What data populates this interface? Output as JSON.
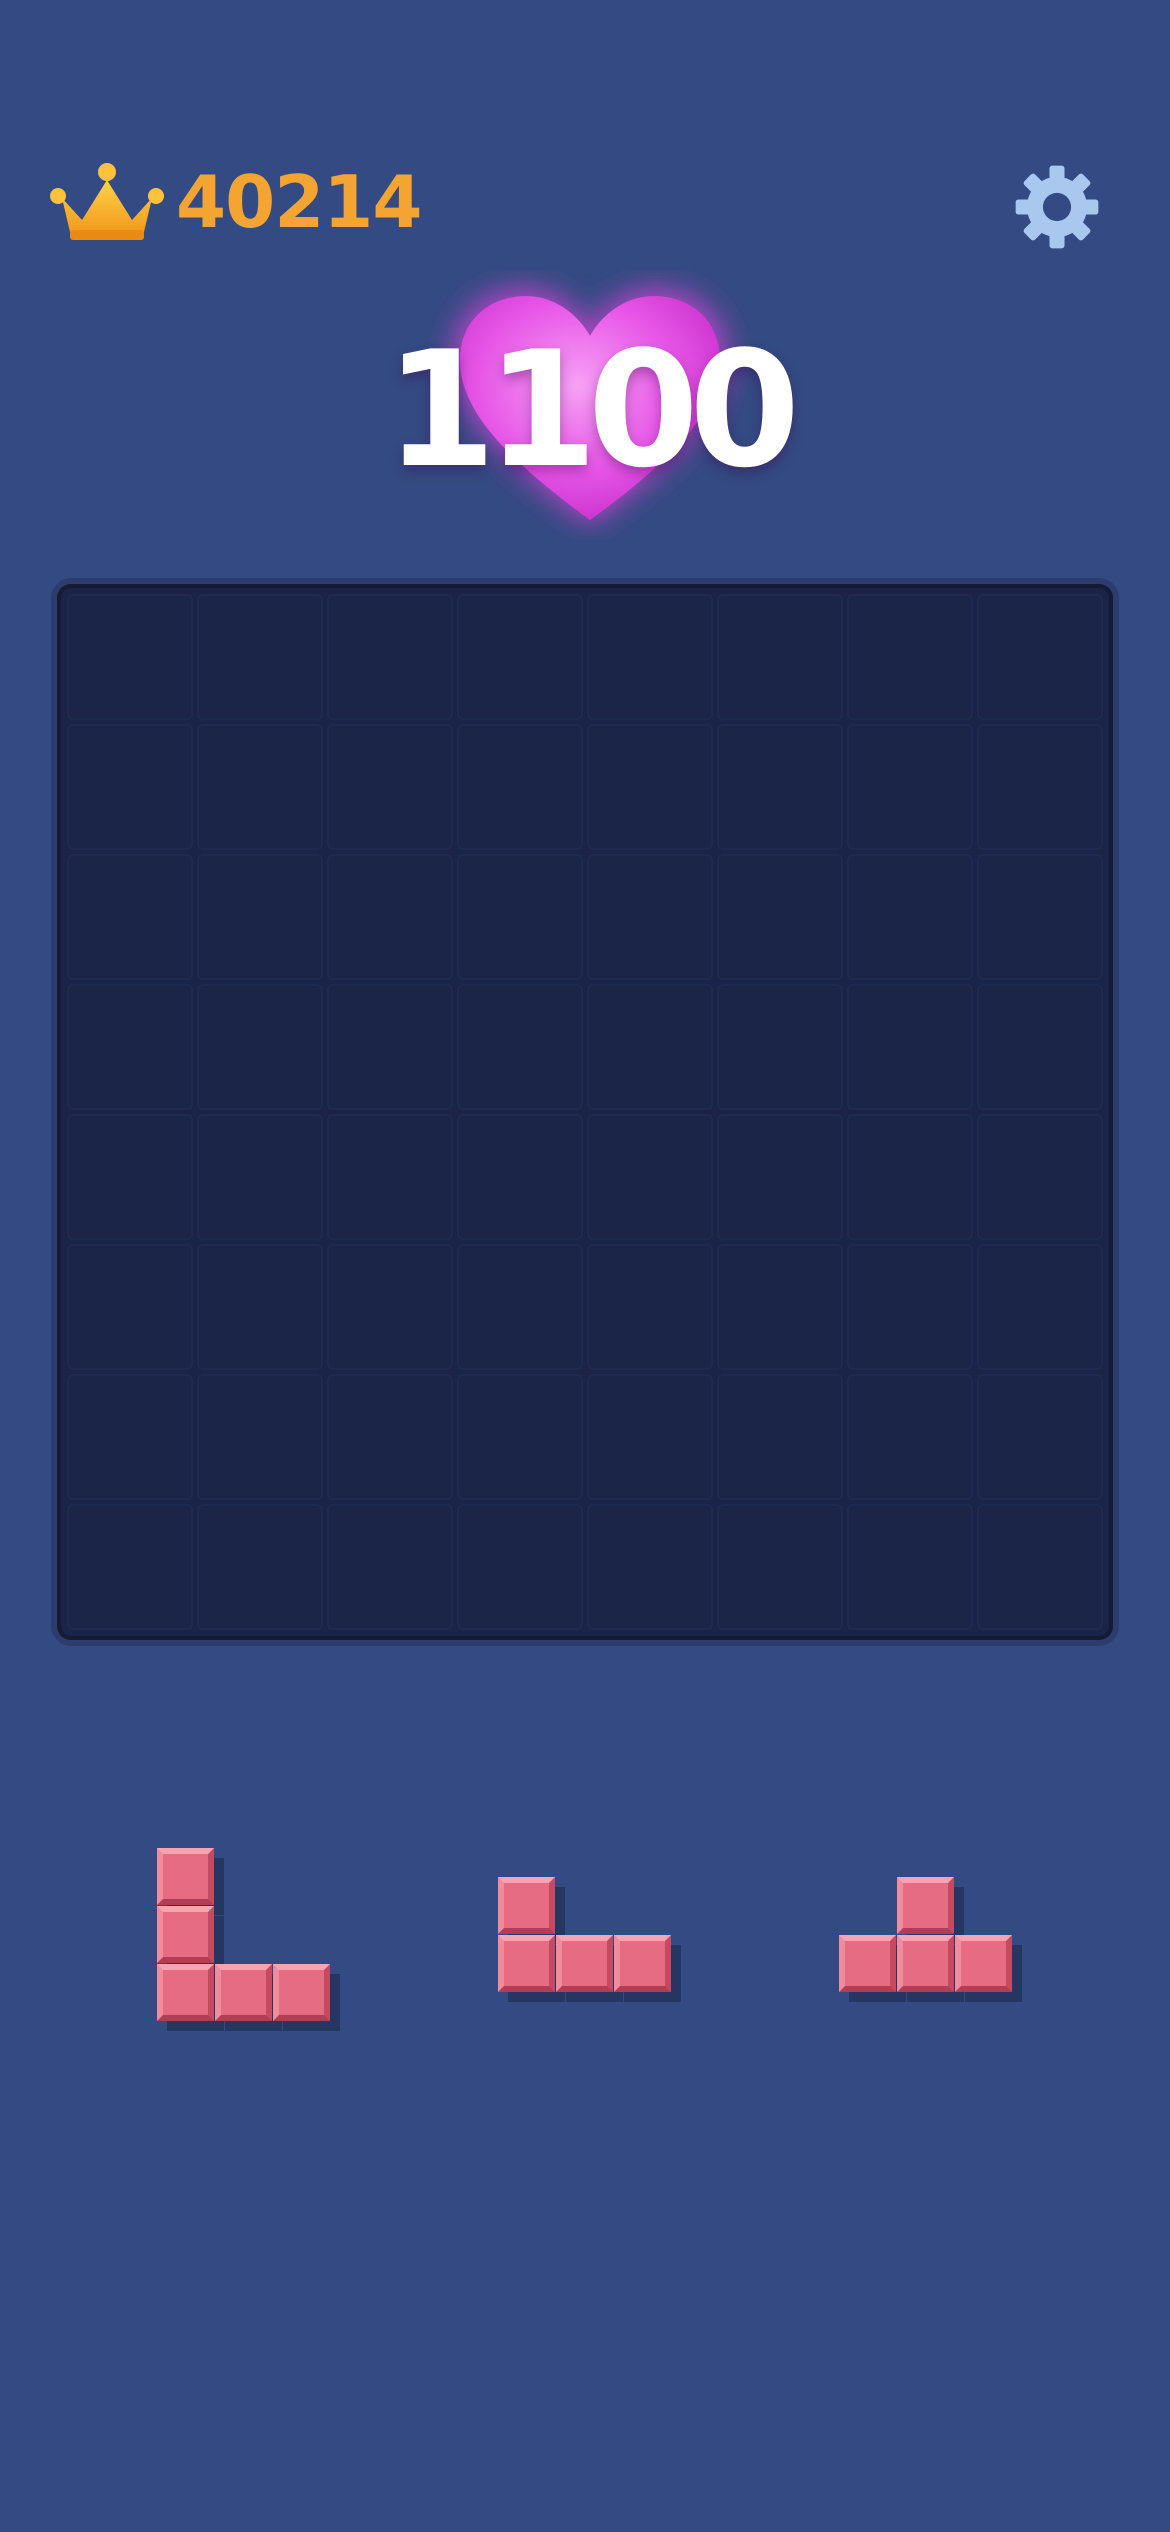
{
  "header": {
    "best_score": "40214",
    "crown_icon": "crown-icon",
    "settings_icon": "gear-icon"
  },
  "score": {
    "current": "1100",
    "heart_icon": "heart-icon"
  },
  "board": {
    "rows": 8,
    "cols": 8,
    "filled_cells": []
  },
  "tray": {
    "pieces": [
      {
        "name": "piece-l-shape",
        "shape": [
          "100",
          "100",
          "111"
        ],
        "color": "#e8697f"
      },
      {
        "name": "piece-j-shape",
        "shape": [
          "100",
          "111"
        ],
        "color": "#e8697f"
      },
      {
        "name": "piece-l-flat-shape",
        "shape": [
          "010",
          "111"
        ],
        "color": "#e8697f"
      }
    ]
  },
  "colors": {
    "background": "#344a82",
    "board": "#1b2446",
    "accent": "#f4a431",
    "block": "#e8697f"
  }
}
